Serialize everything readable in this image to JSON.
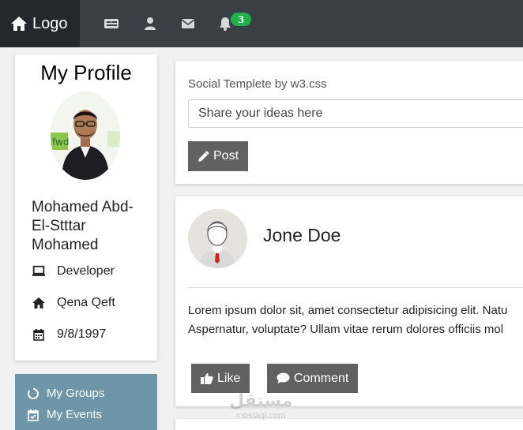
{
  "nav": {
    "logo_label": "Logo",
    "icons": [
      "news-icon",
      "user-icon",
      "envelope-icon",
      "bell-icon"
    ],
    "notification_count": "3"
  },
  "profile": {
    "title": "My Profile",
    "name": "Mohamed Abd-El-Stttar Mohamed",
    "job": "Developer",
    "location": "Qena Qeft",
    "birthday": "9/8/1997"
  },
  "groups": {
    "items": [
      {
        "label": "My Groups",
        "icon": "circle-notch-icon"
      },
      {
        "label": "My Events",
        "icon": "calendar-check-icon"
      }
    ]
  },
  "compose": {
    "label": "Social Templete by w3.css",
    "placeholder": "Share your ideas here",
    "post_label": "Post"
  },
  "post": {
    "author": "Jone Doe",
    "text_line1": "Lorem ipsum dolor sit, amet consectetur adipisicing elit. Natu",
    "text_line2": "Aspernatur, voluptate? Ullam vitae rerum dolores officiis mol",
    "like_label": "Like",
    "comment_label": "Comment"
  },
  "watermark": {
    "arabic": "مستقل",
    "latin": "mostaql.com"
  },
  "colors": {
    "nav_bg": "#3a3f45",
    "logo_bg": "#24282c",
    "groups_bg": "#6e95a8",
    "button_bg": "#616161",
    "badge_bg": "#20b14a"
  }
}
